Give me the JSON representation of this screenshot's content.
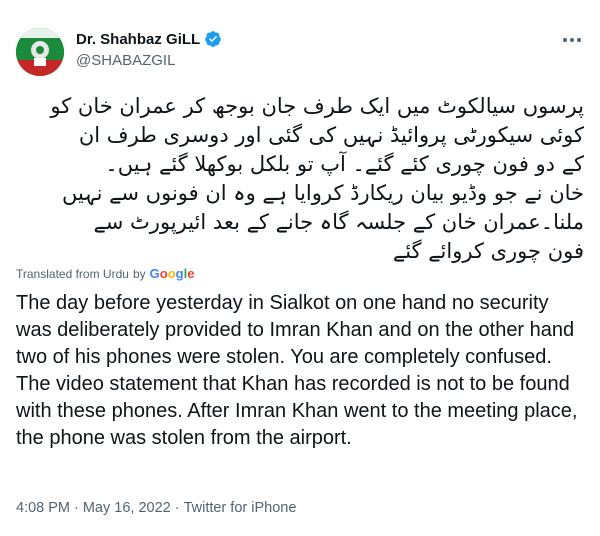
{
  "author": {
    "display_name": "Dr. Shahbaz GiLL",
    "handle": "@SHABAZGIL",
    "verified": true,
    "icon_verified": "verified-badge-icon",
    "avatar_color": "#1b8a3a"
  },
  "menu": {
    "icon": "more-dots-icon"
  },
  "tweet": {
    "urdu_lines": [
      "پرسوں سیالکوٹ میں ایک طرف جان بوجھ کر عمران خان کو",
      "کوئی سیکورٹی پروائیڈ نہیں کی گئی اور دوسری طرف ان",
      "کے دو فون چوری کئے گئے۔ آپ تو بلکل بوکھلا گئے ہیں۔",
      "خان نے جو وڈیو بیان ریکارڈ کروایا ہے وہ ان فونوں سے نہیں",
      "ملنا۔عمران خان کے جلسہ گاہ جانے کے بعد ائیرپورٹ سے",
      "فون چوری کروائے گئے"
    ],
    "translated_label": "Translated from Urdu",
    "translated_by": "by",
    "google_logo": "Google",
    "english": "The day before yesterday in Sialkot on one hand no security was deliberately provided to Imran Khan and on the other hand two of his phones were stolen. You are completely confused. The video statement that Khan has recorded is not to be found with these phones. After Imran Khan went to the meeting place, the phone was stolen from the airport."
  },
  "meta": {
    "time": "4:08 PM",
    "date": "May 16, 2022",
    "source": "Twitter for iPhone",
    "separator": "·"
  },
  "colors": {
    "text": "#0f1419",
    "secondary": "#536471",
    "verified_blue": "#1d9bf0"
  }
}
